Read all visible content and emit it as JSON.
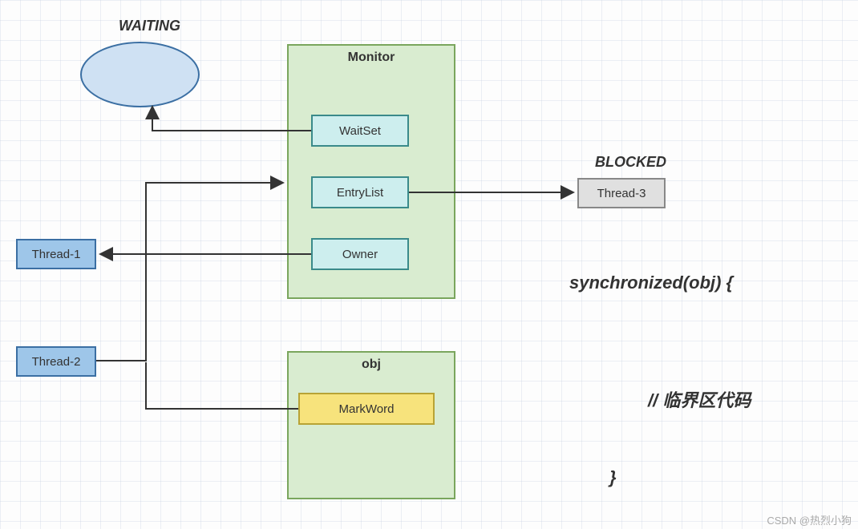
{
  "labels": {
    "waiting": "WAITING",
    "blocked": "BLOCKED"
  },
  "monitor": {
    "title": "Monitor",
    "waitset": "WaitSet",
    "entrylist": "EntryList",
    "owner": "Owner"
  },
  "obj": {
    "title": "obj",
    "markword": "MarkWord"
  },
  "threads": {
    "t1": "Thread-1",
    "t2": "Thread-2",
    "t3": "Thread-3"
  },
  "code": {
    "line1": "synchronized(obj) {",
    "line2": "// 临界区代码",
    "line3": "}"
  },
  "watermark": "CSDN @热烈小狗"
}
